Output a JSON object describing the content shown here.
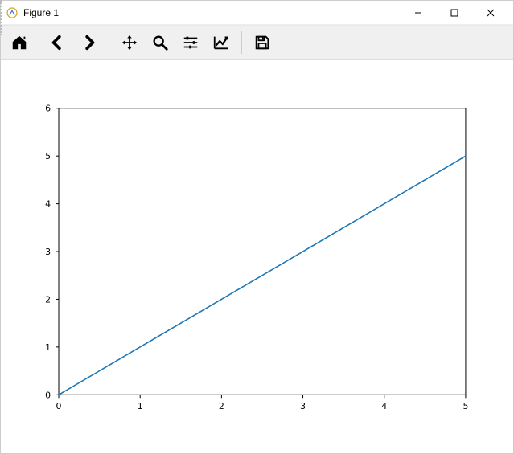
{
  "window": {
    "title": "Figure 1"
  },
  "toolbar": {
    "icons": {
      "home": "home-icon",
      "back": "back-icon",
      "forward": "forward-icon",
      "pan": "pan-icon",
      "zoom": "zoom-icon",
      "subplots": "subplots-icon",
      "axes": "axes-icon",
      "save": "save-icon"
    }
  },
  "chart_data": {
    "type": "line",
    "x": [
      0,
      1,
      2,
      3,
      4,
      5
    ],
    "y": [
      0,
      1,
      2,
      3,
      4,
      5
    ],
    "xlabel": "",
    "ylabel": "",
    "title": "",
    "xlim": [
      0,
      5
    ],
    "ylim": [
      0,
      6
    ],
    "xticks": [
      0,
      1,
      2,
      3,
      4,
      5
    ],
    "yticks": [
      0,
      1,
      2,
      3,
      4,
      5,
      6
    ],
    "line_color": "#1f77b4",
    "grid": false
  }
}
